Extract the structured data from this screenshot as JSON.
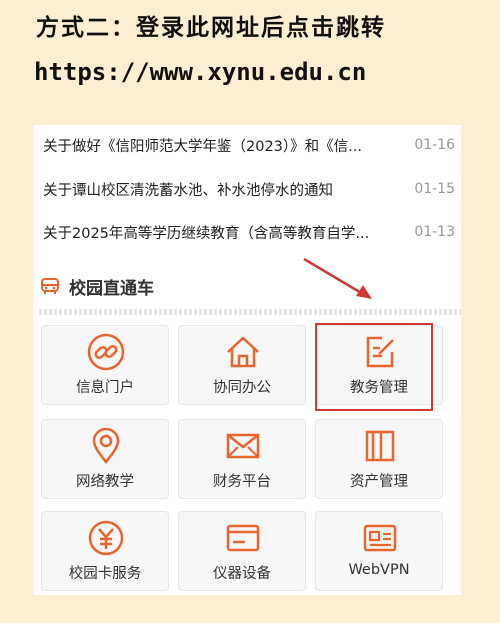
{
  "caption": {
    "heading": "方式二：登录此网址后点击跳转",
    "url": "https://www.xynu.edu.cn"
  },
  "news": [
    {
      "title": "关于做好《信阳师范大学年鉴（2023）》和《信...",
      "date": "01-16"
    },
    {
      "title": "关于谭山校区清洗蓄水池、补水池停水的通知",
      "date": "01-15"
    },
    {
      "title": "关于2025年高等学历继续教育（含高等教育自学...",
      "date": "01-13"
    }
  ],
  "section": {
    "title": "校园直通车",
    "icon": "car-icon"
  },
  "tiles": [
    {
      "label": "信息门户",
      "icon": "link-icon"
    },
    {
      "label": "协同办公",
      "icon": "home-icon"
    },
    {
      "label": "教务管理",
      "icon": "edit-icon"
    },
    {
      "label": "网络教学",
      "icon": "location-pin-icon"
    },
    {
      "label": "财务平台",
      "icon": "mail-icon"
    },
    {
      "label": "资产管理",
      "icon": "book-icon"
    },
    {
      "label": "校园卡服务",
      "icon": "yuan-icon"
    },
    {
      "label": "仪器设备",
      "icon": "card-icon"
    },
    {
      "label": "WebVPN",
      "icon": "id-card-icon"
    }
  ],
  "colors": {
    "accent": "#e8652f",
    "highlight": "#d23a3a",
    "section_text": "#333333"
  }
}
